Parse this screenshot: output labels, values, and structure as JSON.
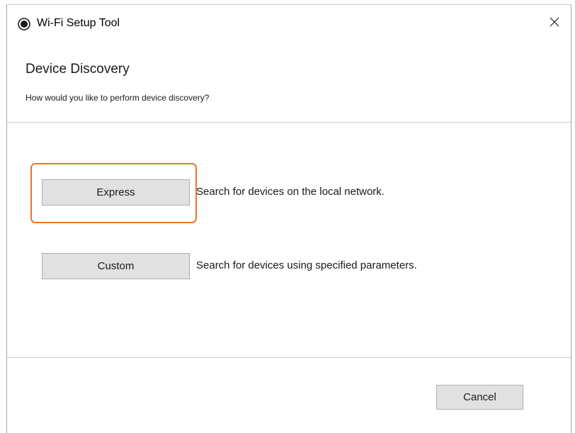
{
  "window": {
    "title": "Wi-Fi Setup Tool",
    "app_icon": "radio-record-icon",
    "close_icon": "close-x-icon"
  },
  "header": {
    "title": "Device Discovery",
    "subtitle": "How would you like to perform device discovery?"
  },
  "options": [
    {
      "button_label": "Express",
      "description": "Search for devices on the local network.",
      "highlighted": true
    },
    {
      "button_label": "Custom",
      "description": "Search for devices using specified parameters.",
      "highlighted": false
    }
  ],
  "footer": {
    "cancel_label": "Cancel"
  },
  "colors": {
    "highlight": "#e8742c",
    "button_face": "#e1e1e1",
    "button_border": "#adadad",
    "divider": "#c9c9c9"
  }
}
